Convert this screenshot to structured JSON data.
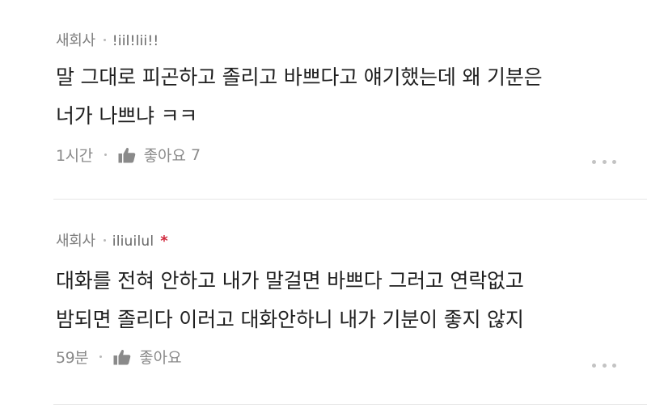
{
  "comments": [
    {
      "company": "새회사",
      "nickname": "!iil!lii!!",
      "line1": "말 그대로 피곤하고 졸리고 바쁘다고 얘기했는데 왜 기분은",
      "line2": "너가 나쁘냐 ㅋㅋ",
      "time": "1시간",
      "like_label": "좋아요",
      "like_count": "7",
      "starred": false
    },
    {
      "company": "새회사",
      "nickname": "iliuilul",
      "star": "*",
      "line1": "대화를 전혀 안하고 내가 말걸면 바쁘다 그러고 연락없고",
      "line2": "밤되면 졸리다 이러고 대화안하니 내가 기분이 좋지 않지",
      "time": "59분",
      "like_label": "좋아요",
      "like_count": "",
      "starred": true
    }
  ],
  "icons": {
    "like": "thumbs-up-icon",
    "more": "more-dots-icon",
    "star_color": "#d0283c"
  }
}
